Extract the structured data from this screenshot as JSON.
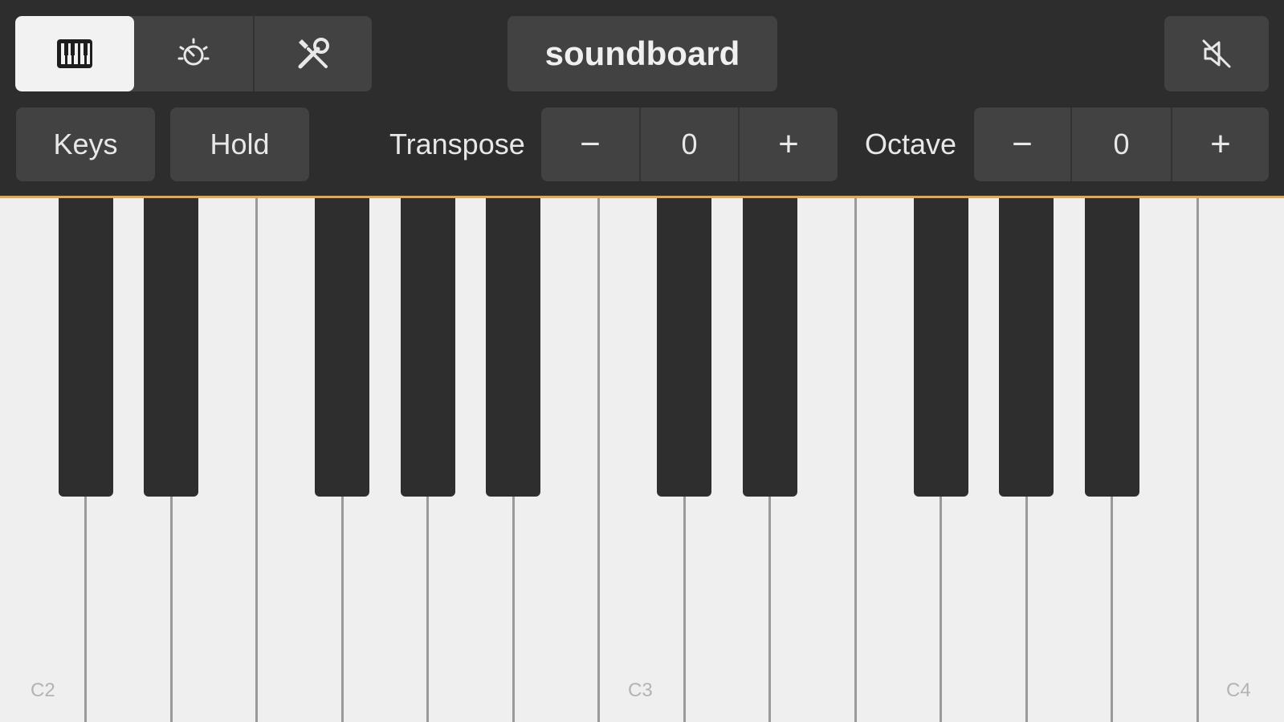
{
  "toolbar": {
    "title": "soundboard",
    "mode_tabs": [
      {
        "name": "keyboard-mode",
        "icon": "piano-keys-icon",
        "selected": true
      },
      {
        "name": "effects-mode",
        "icon": "dial-icon",
        "selected": false
      },
      {
        "name": "tools-mode",
        "icon": "wrench-screwdriver-icon",
        "selected": false
      }
    ],
    "mute_icon": "speaker-muted-icon",
    "keys_label": "Keys",
    "hold_label": "Hold",
    "transpose": {
      "label": "Transpose",
      "minus": "−",
      "value": "0",
      "plus": "+"
    },
    "octave": {
      "label": "Octave",
      "minus": "−",
      "value": "0",
      "plus": "+"
    }
  },
  "keyboard": {
    "note_labels": {
      "c2": "C2",
      "c3": "C3",
      "c4": "C4"
    },
    "white_key_count": 15,
    "colors": {
      "white": "#efefef",
      "black": "#2e2e2e",
      "accent": "#d6a86a",
      "selected_tab": "#f2f2f2"
    }
  }
}
